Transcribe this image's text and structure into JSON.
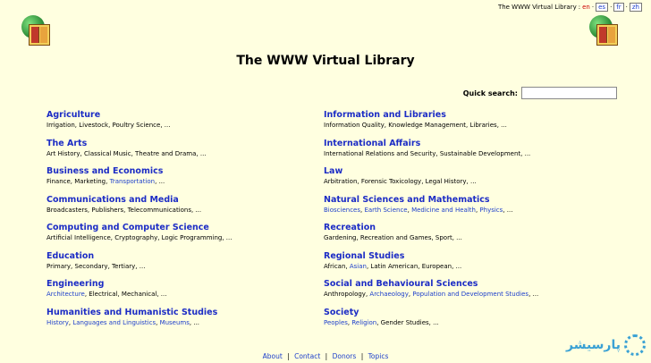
{
  "header": {
    "site_name": "The WWW Virtual Library",
    "site_name_suffix": ":",
    "current_lang": "en",
    "languages": [
      "es",
      "fr",
      "zh"
    ]
  },
  "title": "The WWW Virtual Library",
  "search": {
    "label": "Quick search:",
    "value": "",
    "placeholder": ""
  },
  "left": [
    {
      "title": "Agriculture",
      "sub": [
        {
          "t": "Irrigation, Livestock, Poultry Science, ...",
          "l": false
        }
      ]
    },
    {
      "title": "The Arts",
      "sub": [
        {
          "t": "Art History, Classical Music, Theatre and Drama, ...",
          "l": false
        }
      ]
    },
    {
      "title": "Business and Economics",
      "sub": [
        {
          "t": "Finance, Marketing, ",
          "l": false
        },
        {
          "t": "Transportation",
          "l": true
        },
        {
          "t": ", ...",
          "l": false
        }
      ]
    },
    {
      "title": "Communications and Media",
      "sub": [
        {
          "t": "Broadcasters, Publishers, Telecommunications, ...",
          "l": false
        }
      ]
    },
    {
      "title": "Computing and Computer Science",
      "sub": [
        {
          "t": "Artificial Intelligence, Cryptography, Logic Programming, ...",
          "l": false
        }
      ]
    },
    {
      "title": "Education",
      "sub": [
        {
          "t": "Primary, Secondary, Tertiary, ...",
          "l": false
        }
      ]
    },
    {
      "title": "Engineering",
      "sub": [
        {
          "t": "Architecture",
          "l": true
        },
        {
          "t": ", Electrical, Mechanical, ...",
          "l": false
        }
      ]
    },
    {
      "title": "Humanities and Humanistic Studies",
      "sub": [
        {
          "t": "History",
          "l": true
        },
        {
          "t": ", ",
          "l": false
        },
        {
          "t": "Languages and Linguistics",
          "l": true
        },
        {
          "t": ", ",
          "l": false
        },
        {
          "t": "Museums",
          "l": true
        },
        {
          "t": ", ...",
          "l": false
        }
      ]
    }
  ],
  "right": [
    {
      "title": "Information and Libraries",
      "sub": [
        {
          "t": "Information Quality, Knowledge Management, Libraries, ...",
          "l": false
        }
      ]
    },
    {
      "title": "International Affairs",
      "sub": [
        {
          "t": "International Relations and Security, Sustainable Development, ...",
          "l": false
        }
      ]
    },
    {
      "title": "Law",
      "sub": [
        {
          "t": "Arbitration, Forensic Toxicology, Legal History, ...",
          "l": false
        }
      ]
    },
    {
      "title": "Natural Sciences and Mathematics",
      "sub": [
        {
          "t": "Biosciences",
          "l": true
        },
        {
          "t": ", ",
          "l": false
        },
        {
          "t": "Earth Science",
          "l": true
        },
        {
          "t": ", ",
          "l": false
        },
        {
          "t": "Medicine and Health",
          "l": true
        },
        {
          "t": ", ",
          "l": false
        },
        {
          "t": "Physics",
          "l": true
        },
        {
          "t": ", ...",
          "l": false
        }
      ]
    },
    {
      "title": "Recreation",
      "sub": [
        {
          "t": "Gardening, Recreation and Games, Sport, ...",
          "l": false
        }
      ]
    },
    {
      "title": "Regional Studies",
      "sub": [
        {
          "t": "African, ",
          "l": false
        },
        {
          "t": "Asian",
          "l": true
        },
        {
          "t": ", Latin American, European, ...",
          "l": false
        }
      ]
    },
    {
      "title": "Social and Behavioural Sciences",
      "sub": [
        {
          "t": "Anthropology, ",
          "l": false
        },
        {
          "t": "Archaeology",
          "l": true
        },
        {
          "t": ", ",
          "l": false
        },
        {
          "t": "Population and Development Studies",
          "l": true
        },
        {
          "t": ", ...",
          "l": false
        }
      ]
    },
    {
      "title": "Society",
      "sub": [
        {
          "t": "Peoples",
          "l": true
        },
        {
          "t": ", ",
          "l": false
        },
        {
          "t": "Religion",
          "l": true
        },
        {
          "t": ", Gender Studies, ...",
          "l": false
        }
      ]
    }
  ],
  "footer": {
    "links": [
      "About",
      "Contact",
      "Donors",
      "Topics"
    ],
    "separator": "|"
  },
  "watermark": {
    "text": "پارسیشر"
  }
}
